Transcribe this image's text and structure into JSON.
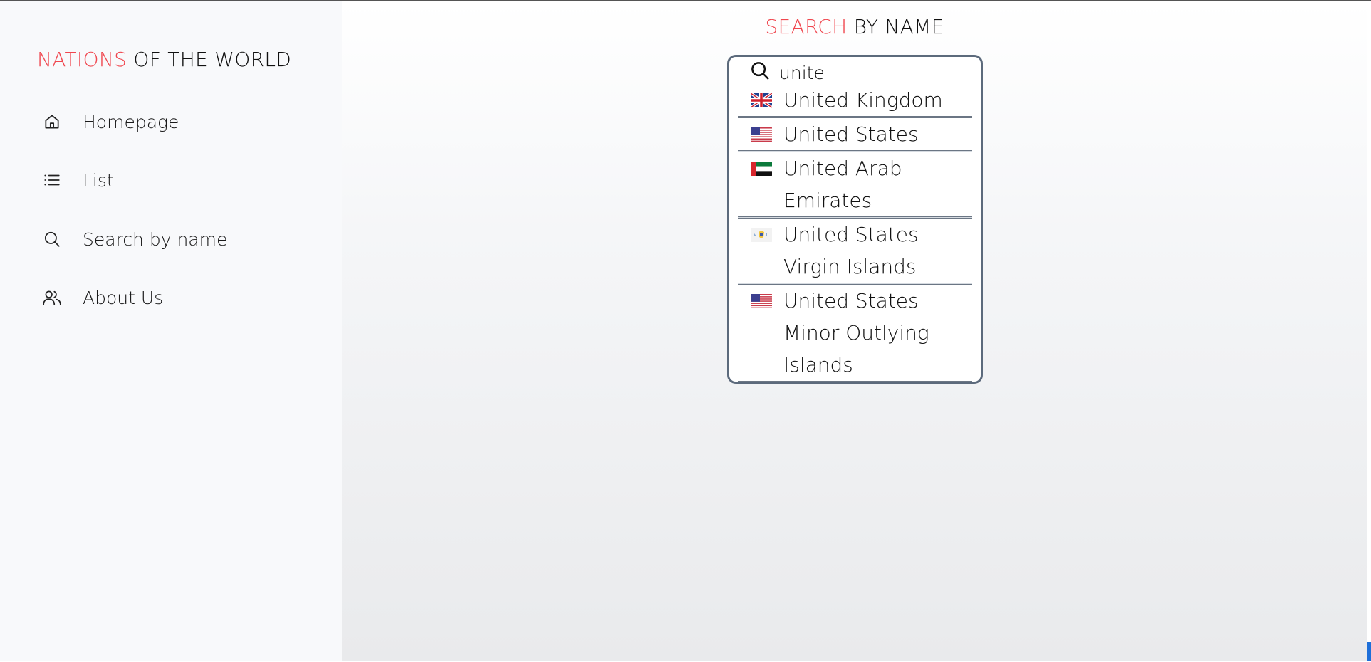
{
  "sidebar": {
    "brand_accent": "NATIONS",
    "brand_rest": "OF THE WORLD",
    "items": [
      {
        "label": "Homepage",
        "icon": "home-icon"
      },
      {
        "label": "List",
        "icon": "list-icon"
      },
      {
        "label": "Search by name",
        "icon": "search-icon"
      },
      {
        "label": "About Us",
        "icon": "users-icon"
      }
    ]
  },
  "main": {
    "title_accent": "SEARCH",
    "title_rest": "BY NAME",
    "search": {
      "value": "unite",
      "placeholder": ""
    },
    "results": [
      {
        "name": "United Kingdom",
        "flag": "gb-flag-icon"
      },
      {
        "name": "United States",
        "flag": "us-flag-icon"
      },
      {
        "name": "United Arab Emirates",
        "flag": "ae-flag-icon"
      },
      {
        "name": "United States Virgin Islands",
        "flag": "vi-flag-icon"
      },
      {
        "name": "United States Minor Outlying Islands",
        "flag": "um-flag-icon"
      }
    ]
  },
  "colors": {
    "accent": "#f0474f",
    "border": "#5c6a7c",
    "sidebar_bg": "#f8f9fb"
  }
}
